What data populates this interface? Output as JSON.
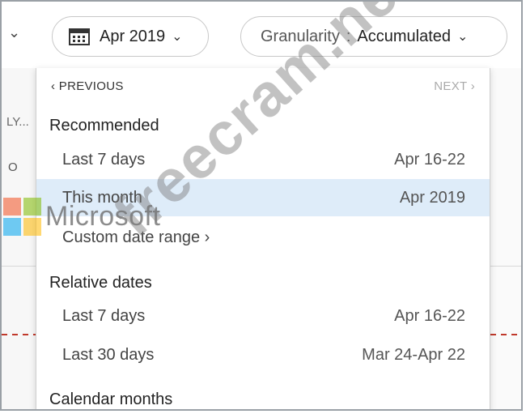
{
  "toolbar": {
    "date_label": "Apr 2019",
    "granularity_label": "Granularity",
    "granularity_sep": ":",
    "granularity_value": "Accumulated"
  },
  "background": {
    "text1": "LY...",
    "text2": "O"
  },
  "dropdown": {
    "previous": "‹  PREVIOUS",
    "next": "NEXT  ›",
    "sections": [
      {
        "title": "Recommended",
        "items": [
          {
            "label": "Last 7 days",
            "value": "Apr 16-22"
          },
          {
            "label": "This month",
            "value": "Apr 2019",
            "selected": true
          },
          {
            "label": "Custom date range ›",
            "value": ""
          }
        ]
      },
      {
        "title": "Relative dates",
        "items": [
          {
            "label": "Last 7 days",
            "value": "Apr 16-22"
          },
          {
            "label": "Last 30 days",
            "value": "Mar 24-Apr 22"
          }
        ]
      },
      {
        "title": "Calendar months",
        "items": []
      }
    ]
  },
  "watermarks": {
    "brand": "Microsoft",
    "site": "freecram.net"
  },
  "icons": {
    "calendar": "calendar-icon",
    "chevron": "chevron-down-icon",
    "logo": "microsoft-logo"
  },
  "colors": {
    "selected_row": "#deecf9",
    "dash_line": "#c0392b"
  }
}
